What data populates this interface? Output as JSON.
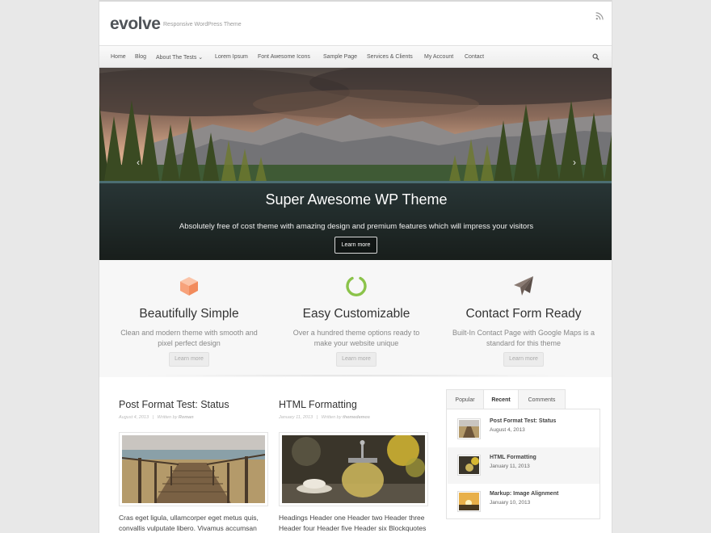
{
  "site": {
    "title": "evolve",
    "tagline": "Responsive WordPress Theme"
  },
  "nav": {
    "items": [
      {
        "label": "Home"
      },
      {
        "label": "Blog"
      },
      {
        "label": "About The Tests ⌄"
      },
      {
        "label": "Lorem Ipsum"
      },
      {
        "label": "Font Awesome Icons"
      },
      {
        "label": "Sample Page"
      },
      {
        "label": "Services & Clients"
      },
      {
        "label": "My Account"
      },
      {
        "label": "Contact"
      }
    ],
    "search_icon": "search-icon",
    "rss_icon": "rss-icon"
  },
  "hero": {
    "title": "Super Awesome WP Theme",
    "subtitle": "Absolutely free of cost theme with amazing design and premium features which will impress your visitors",
    "button": "Learn more",
    "prev": "‹",
    "next": "›"
  },
  "features": [
    {
      "icon": "cube-icon",
      "color": "#f7a27b",
      "title": "Beautifully Simple",
      "text": "Clean and modern theme with smooth and pixel perfect design",
      "button": "Learn more"
    },
    {
      "icon": "circle-notch-icon",
      "color": "#8bc34a",
      "title": "Easy Customizable",
      "text": "Over a hundred theme options ready to make your website unique",
      "button": "Learn more"
    },
    {
      "icon": "paper-plane-icon",
      "color": "#6d5f58",
      "title": "Contact Form Ready",
      "text": "Built-In Contact Page with Google Maps is a standard for this theme",
      "button": "Learn more"
    }
  ],
  "posts": [
    {
      "title": "Post Format Test: Status",
      "date": "August 4, 2013",
      "written_by": "Written by",
      "author": "Roman",
      "excerpt": "Cras eget ligula, ullamcorper eget metus quis, convallis vulputate libero. Vivamus accumsan"
    },
    {
      "title": "HTML Formatting",
      "date": "January 11, 2013",
      "written_by": "Written by",
      "author": "themedemos",
      "excerpt": "Headings Header one Header two Header three Header four Header five Header six Blockquotes"
    }
  ],
  "widget": {
    "tabs": [
      {
        "label": "Popular"
      },
      {
        "label": "Recent"
      },
      {
        "label": "Comments"
      }
    ],
    "active_tab": "Recent",
    "recent": [
      {
        "title": "Post Format Test: Status",
        "date": "August 4, 2013"
      },
      {
        "title": "HTML Formatting",
        "date": "January 11, 2013"
      },
      {
        "title": "Markup: Image Alignment",
        "date": "January 10, 2013"
      }
    ]
  },
  "colors": {
    "accent_orange": "#f7a27b",
    "accent_green": "#8bc34a",
    "accent_brown": "#6d5f58"
  }
}
